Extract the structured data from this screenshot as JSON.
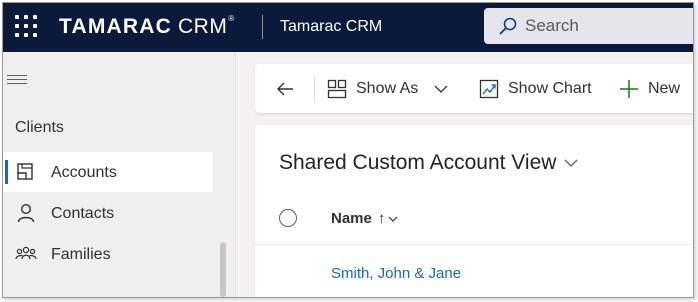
{
  "topbar": {
    "logo_main": "TAMARAC",
    "logo_sub": "CRM",
    "logo_tm": "®",
    "app_name": "Tamarac CRM",
    "search_placeholder": "Search",
    "background_color": "#0b1a3a"
  },
  "sidebar": {
    "group_title": "Clients",
    "items": [
      {
        "label": "Accounts",
        "icon": "accounts-icon",
        "active": true
      },
      {
        "label": "Contacts",
        "icon": "person-icon",
        "active": false
      },
      {
        "label": "Families",
        "icon": "people-group-icon",
        "active": false
      }
    ],
    "active_accent_color": "#0f6cbd"
  },
  "commandbar": {
    "back_icon": "arrow-left-icon",
    "show_as_label": "Show As",
    "show_chart_label": "Show Chart",
    "new_label": "New",
    "new_icon_color": "#107c10"
  },
  "grid": {
    "view_title": "Shared Custom Account View",
    "column_header": "Name",
    "sort_indicator": "↑",
    "rows": [
      {
        "name": "Smith, John & Jane"
      }
    ],
    "link_color": "#0f6cbd"
  }
}
